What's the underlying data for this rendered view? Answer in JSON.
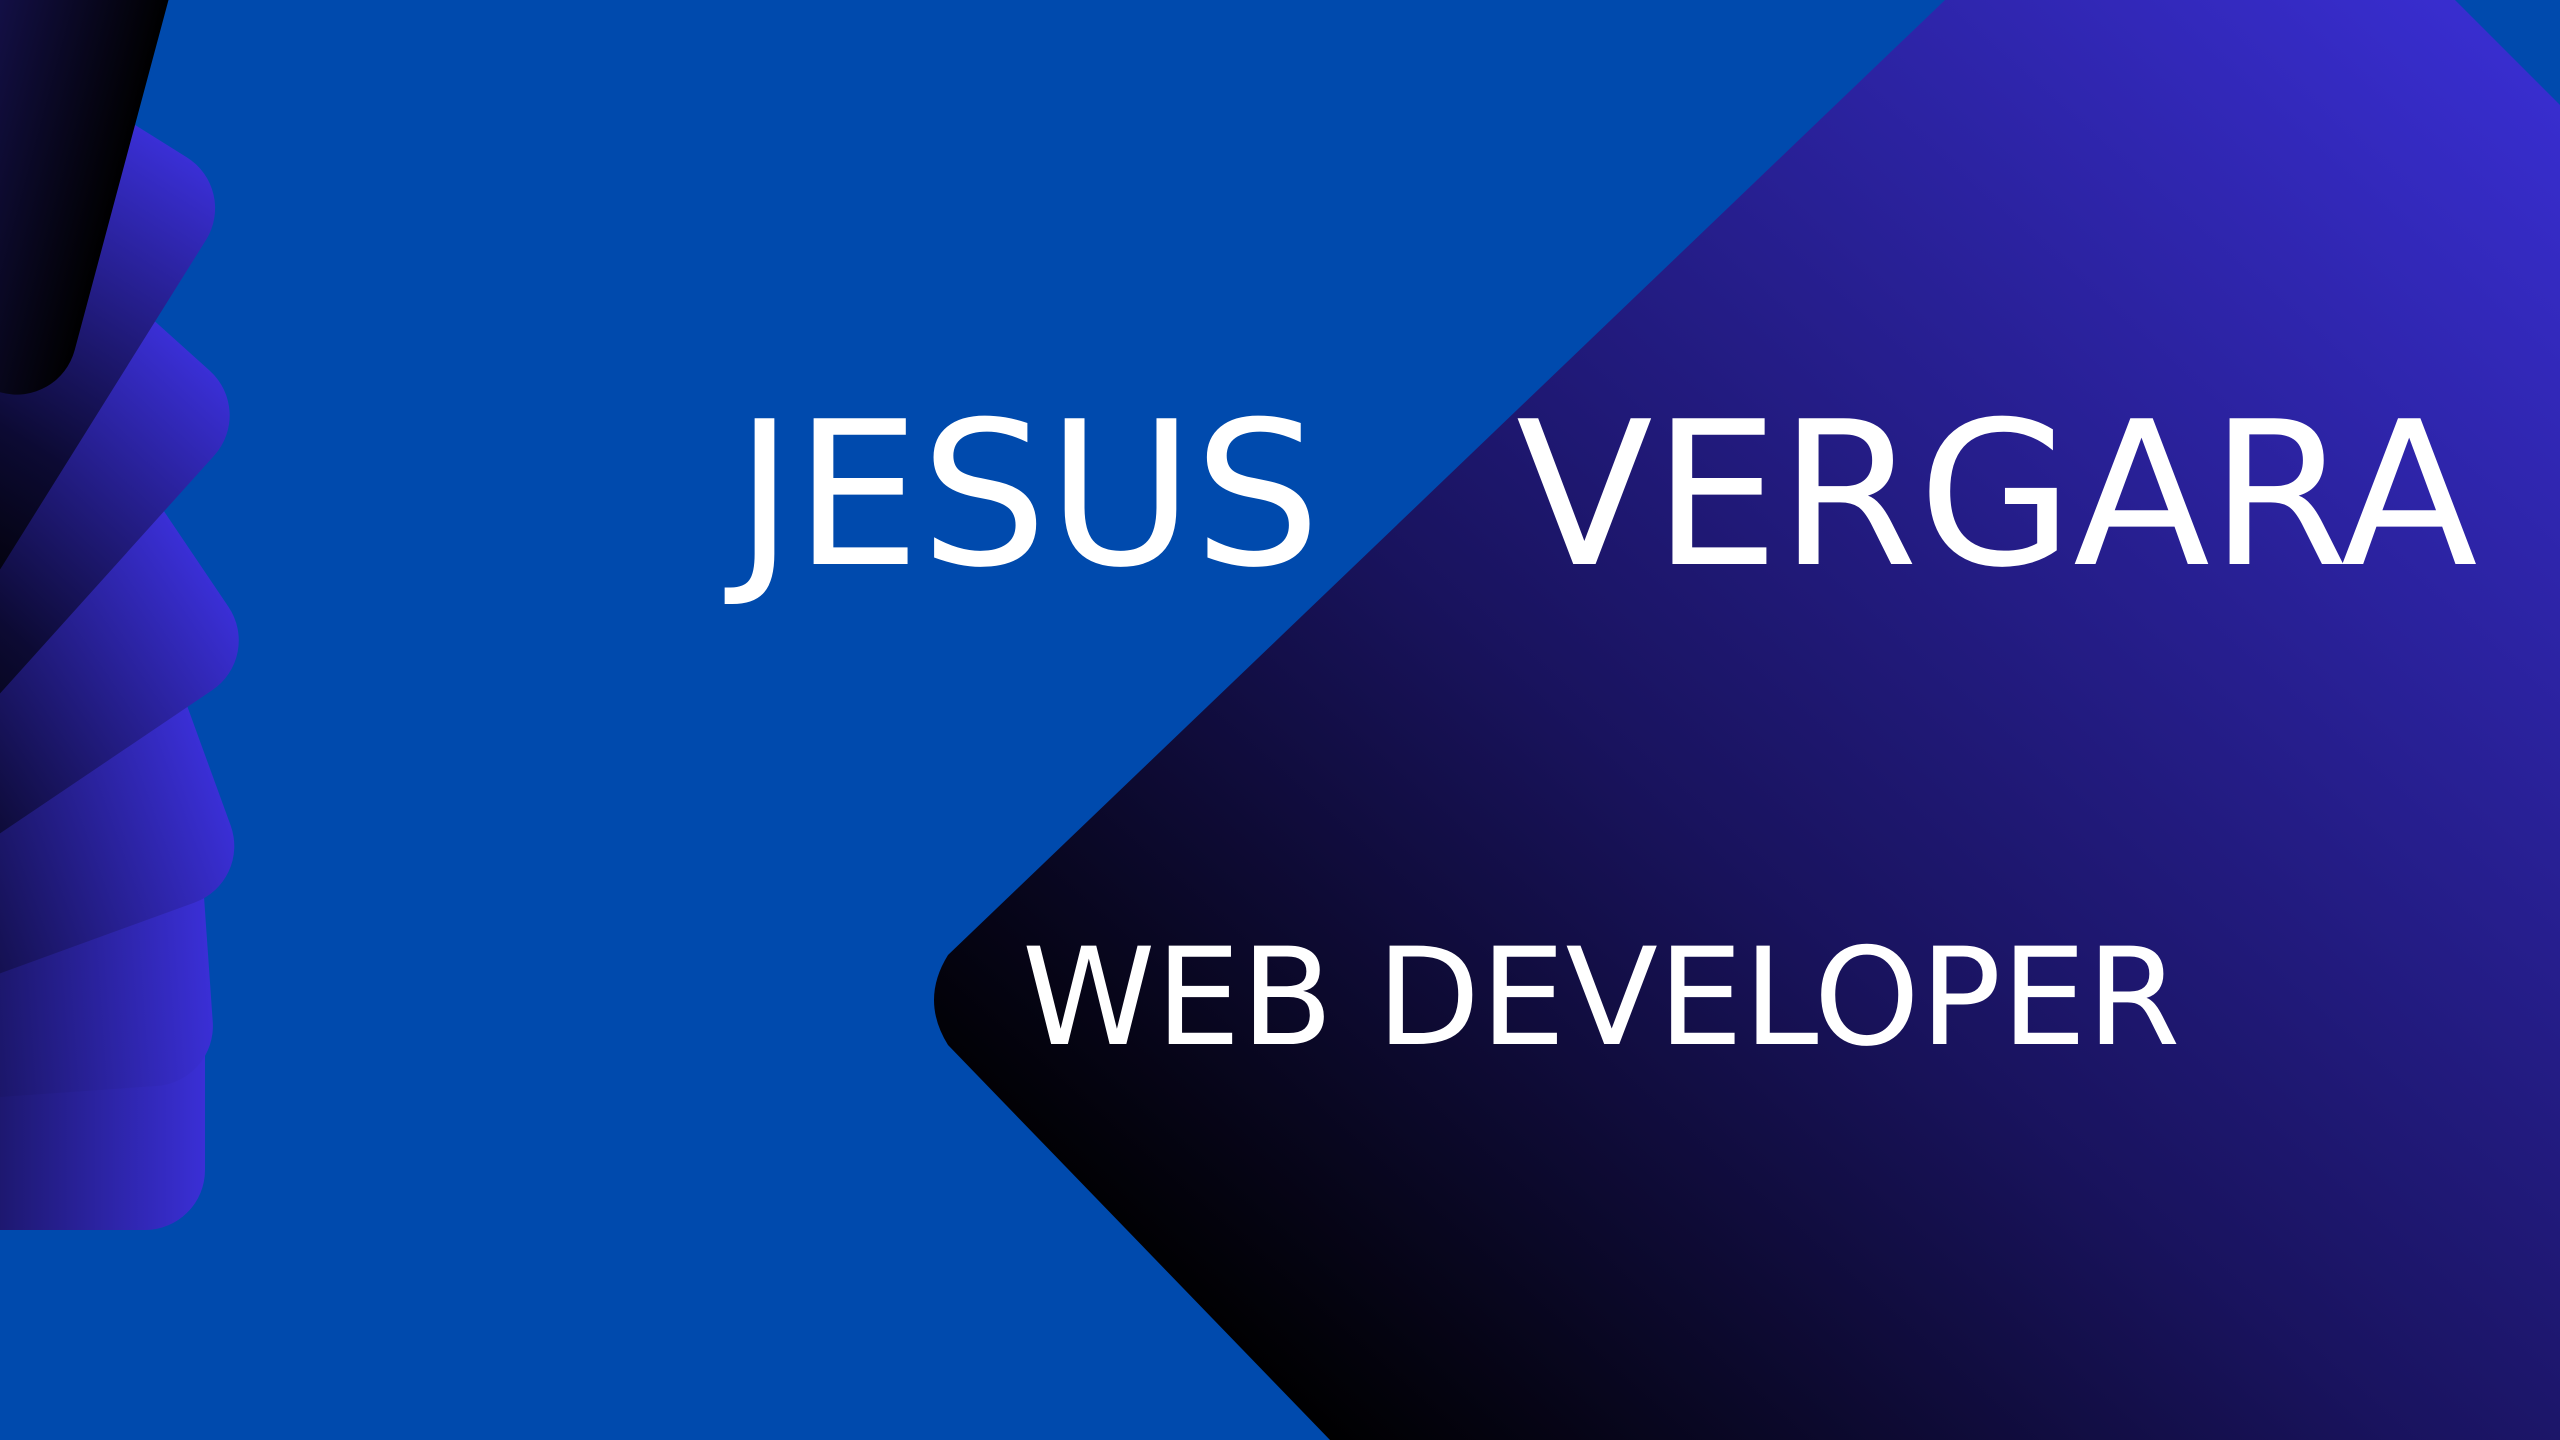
{
  "hero": {
    "first_name": "JESUS",
    "last_name": "VERGARA",
    "role": "WEB DEVELOPER"
  },
  "colors": {
    "background": "#004aad",
    "accent_light": "#3a2fd6",
    "accent_dark": "#000000",
    "text": "#ffffff"
  }
}
